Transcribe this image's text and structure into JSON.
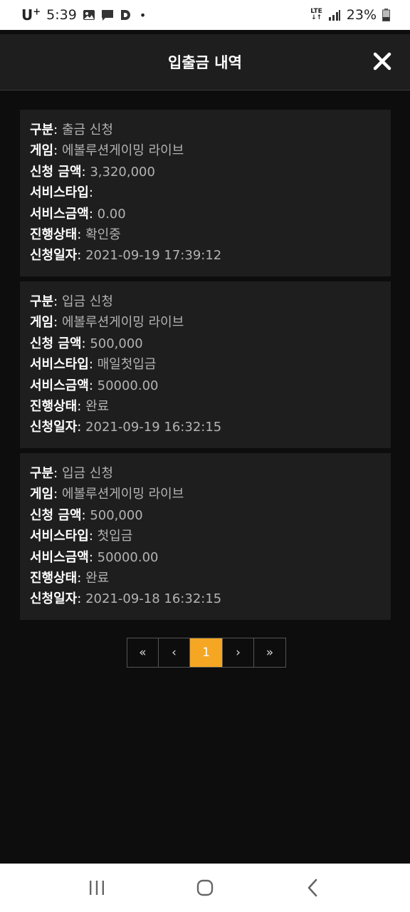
{
  "status_bar": {
    "carrier": "U",
    "carrier_sup": "+",
    "time": "5:39",
    "network": "LTE",
    "battery": "23%"
  },
  "header": {
    "title": "입출금 내역"
  },
  "labels": {
    "type": "구분",
    "game": "게임",
    "amount": "신청 금액",
    "service_type": "서비스타입",
    "service_amount": "서비스금액",
    "status": "진행상태",
    "date": "신청일자",
    "separator": ":"
  },
  "records": [
    {
      "type": "출금 신청",
      "game": "에볼루션게이밍 라이브",
      "amount": "3,320,000",
      "service_type": "",
      "service_amount": "0.00",
      "status": "확인중",
      "date": "2021-09-19 17:39:12"
    },
    {
      "type": "입금 신청",
      "game": "에볼루션게이밍 라이브",
      "amount": "500,000",
      "service_type": "매일첫입금",
      "service_amount": "50000.00",
      "status": "완료",
      "date": "2021-09-19 16:32:15"
    },
    {
      "type": "입금 신청",
      "game": "에볼루션게이밍 라이브",
      "amount": "500,000",
      "service_type": "첫입금",
      "service_amount": "50000.00",
      "status": "완료",
      "date": "2021-09-18 16:32:15"
    }
  ],
  "pagination": {
    "first": "«",
    "prev": "‹",
    "current": "1",
    "next": "›",
    "last": "»"
  },
  "colors": {
    "accent": "#f5a623",
    "card_bg": "#1e1e1e",
    "page_bg": "#0d0d0d"
  }
}
